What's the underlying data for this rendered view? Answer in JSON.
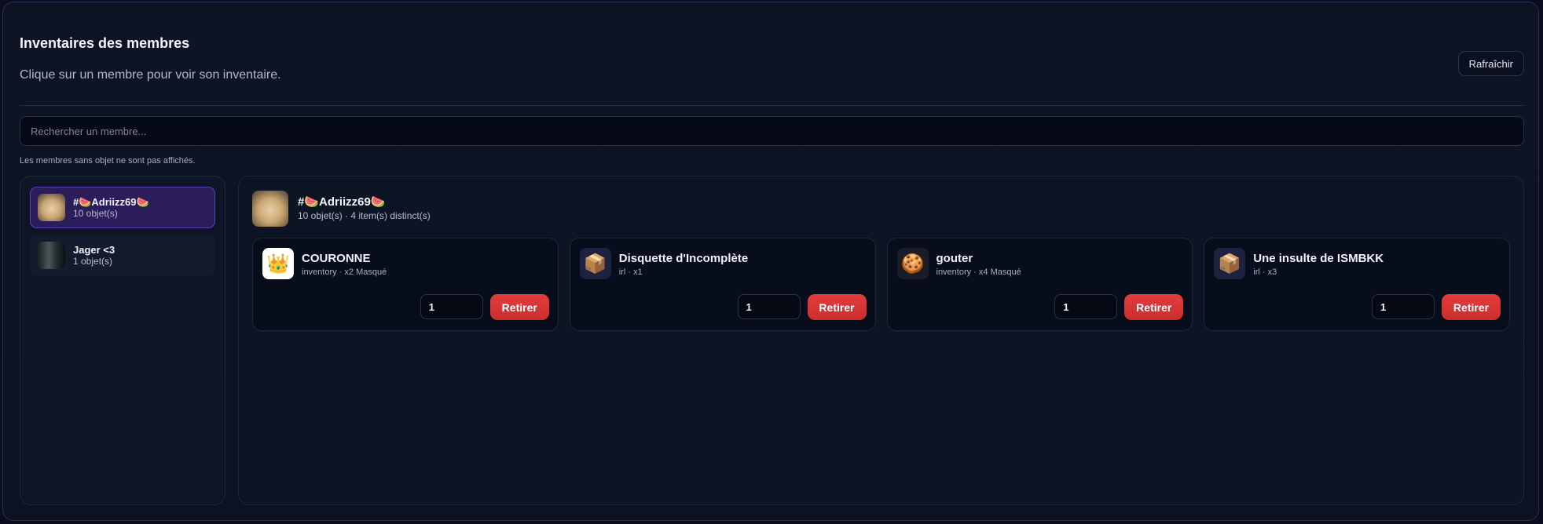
{
  "header": {
    "title": "Inventaires des membres",
    "subtitle": "Clique sur un membre pour voir son inventaire.",
    "refresh_label": "Rafraîchir"
  },
  "search": {
    "placeholder": "Rechercher un membre...",
    "value": ""
  },
  "note": "Les membres sans objet ne sont pas affichés.",
  "members": [
    {
      "name": "#🍉Adriizz69🍉",
      "count": "10 objet(s)",
      "avatar": "cat-avatar",
      "active": true
    },
    {
      "name": "Jager <3",
      "count": "1 objet(s)",
      "avatar": "jager-avatar",
      "active": false
    }
  ],
  "selected": {
    "name": "#🍉Adriizz69🍉",
    "meta": "10 objet(s) · 4 item(s) distinct(s)",
    "avatar": "cat-avatar"
  },
  "items": [
    {
      "name": "COURONNE",
      "meta": "inventory · x2 Masqué",
      "icon": "crown-icon",
      "glyph": "👑",
      "qty": "1",
      "action": "Retirer"
    },
    {
      "name": "Disquette d'Incomplète",
      "meta": "irl · x1",
      "icon": "package-icon",
      "glyph": "📦",
      "qty": "1",
      "action": "Retirer"
    },
    {
      "name": "gouter",
      "meta": "inventory · x4 Masqué",
      "icon": "milk-cookies-icon",
      "glyph": "🍪",
      "qty": "1",
      "action": "Retirer"
    },
    {
      "name": "Une insulte de ISMBKK",
      "meta": "irl · x3",
      "icon": "package-icon",
      "glyph": "📦",
      "qty": "1",
      "action": "Retirer"
    }
  ],
  "colors": {
    "accent": "#5b42b4",
    "danger": "#e23d3d",
    "background": "#0a0e1c"
  }
}
